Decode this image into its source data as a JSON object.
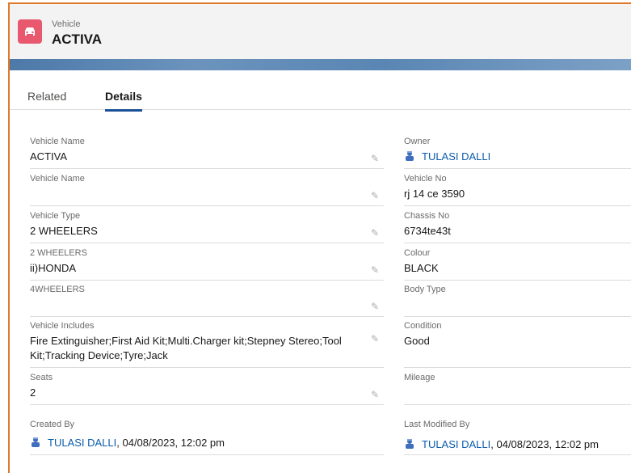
{
  "header": {
    "object_type": "Vehicle",
    "record_title": "ACTIVA",
    "icon": "car-icon",
    "icon_color": "#e8586f"
  },
  "tabs": [
    {
      "label": "Related",
      "active": false
    },
    {
      "label": "Details",
      "active": true
    }
  ],
  "left_fields": [
    {
      "label": "Vehicle Name",
      "value": "ACTIVA"
    },
    {
      "label": "Vehicle Name",
      "value": ""
    },
    {
      "label": "Vehicle Type",
      "value": "2 WHEELERS"
    },
    {
      "label": "2 WHEELERS",
      "value": "ii)HONDA"
    },
    {
      "label": "4WHEELERS",
      "value": ""
    },
    {
      "label": "Vehicle Includes",
      "value": "Fire Extinguisher;First Aid Kit;Multi.Charger kit;Stepney Stereo;Tool Kit;Tracking Device;Tyre;Jack"
    },
    {
      "label": "Seats",
      "value": "2"
    }
  ],
  "right_fields": [
    {
      "label": "Owner",
      "value": "TULASI DALLI"
    },
    {
      "label": "Vehicle No",
      "value": "rj 14 ce 3590"
    },
    {
      "label": "Chassis No",
      "value": "6734te43t"
    },
    {
      "label": "Colour",
      "value": "BLACK"
    },
    {
      "label": "Body Type",
      "value": ""
    },
    {
      "label": "Condition",
      "value": "Good"
    },
    {
      "label": "Mileage",
      "value": ""
    }
  ],
  "created": {
    "label": "Created By",
    "user": "TULASI DALLI",
    "datetime": ", 04/08/2023, 12:02 pm"
  },
  "modified": {
    "label": "Last Modified By",
    "user": "TULASI DALLI",
    "datetime": ", 04/08/2023, 12:02 pm"
  },
  "colors": {
    "accent": "#1b5297",
    "link": "#0b5cab",
    "band": "#5a86b3"
  }
}
